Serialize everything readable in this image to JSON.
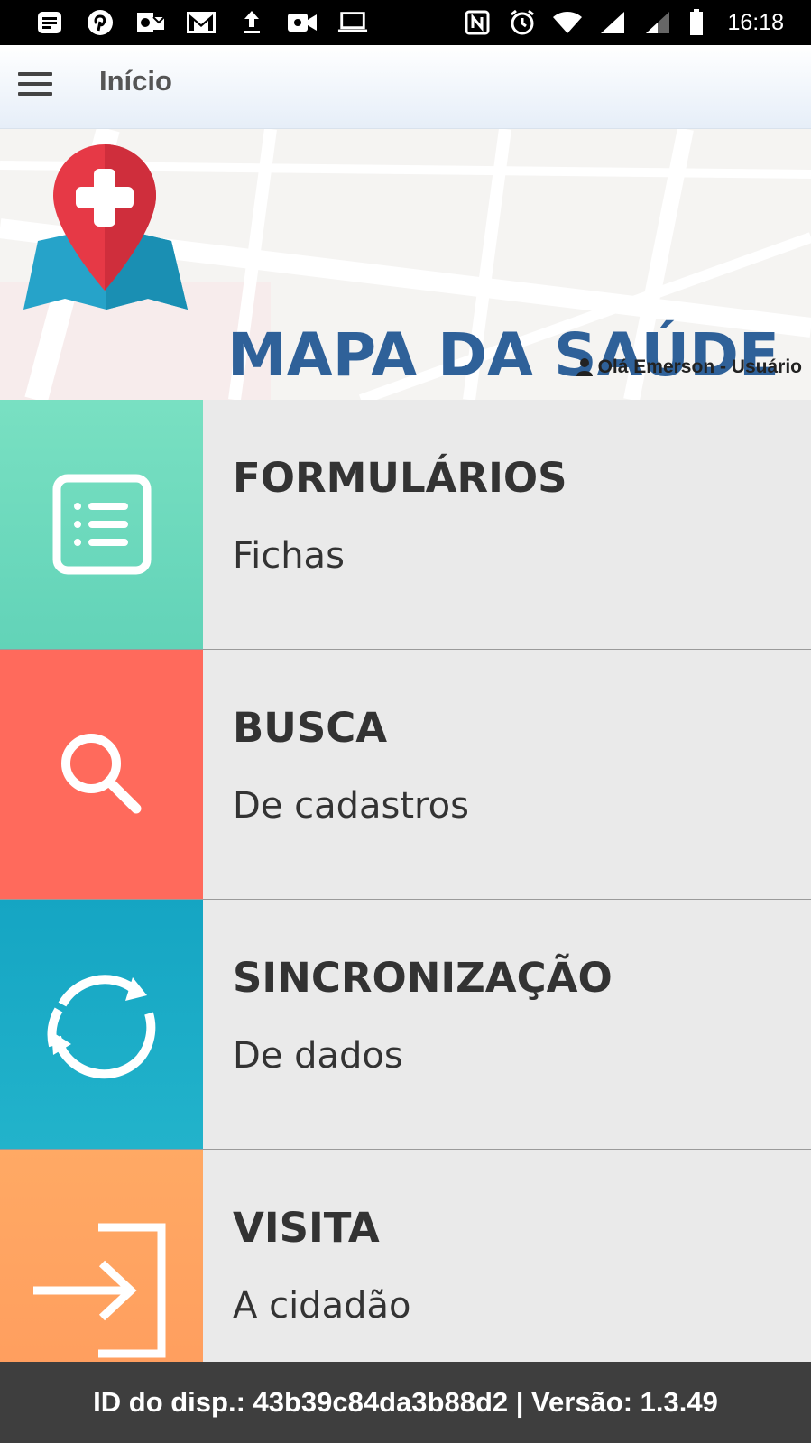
{
  "status_bar": {
    "time": "16:18",
    "left_icons": [
      "notes-icon",
      "pinterest-icon",
      "outlook-icon",
      "gmail-icon",
      "upload-icon",
      "video-icon",
      "laptop-icon"
    ],
    "right_icons": [
      "nfc-icon",
      "alarm-icon",
      "wifi-icon",
      "signal-icon",
      "signal-weak-icon",
      "battery-icon"
    ]
  },
  "app_bar": {
    "title": "Início",
    "menu_icon": "hamburger-icon"
  },
  "banner": {
    "logo_title": "MAPA DA SAÚDE",
    "greeting": "Olá Emerson - Usuário",
    "greeting_icon": "user-icon",
    "logo_icon": "map-pin-cross-icon"
  },
  "menu": {
    "items": [
      {
        "title": "FORMULÁRIOS",
        "subtitle": "Fichas",
        "icon": "form-list-icon",
        "color": "#6fdcbd"
      },
      {
        "title": "BUSCA",
        "subtitle": "De cadastros",
        "icon": "search-icon",
        "color": "#ff6a5c"
      },
      {
        "title": "SINCRONIZAÇÃO",
        "subtitle": "De dados",
        "icon": "sync-icon",
        "color": "#1aabc6"
      },
      {
        "title": "VISITA",
        "subtitle": "A cidadão",
        "icon": "sign-in-icon",
        "color": "#ffa463"
      }
    ]
  },
  "footer": {
    "text": "ID do disp.: 43b39c84da3b88d2 | Versão: 1.3.49"
  },
  "colors": {
    "brand_blue": "#2f6199",
    "footer_bg": "#3e3e3e",
    "pin_red": "#e63946",
    "map_blue": "#26a3c9"
  }
}
